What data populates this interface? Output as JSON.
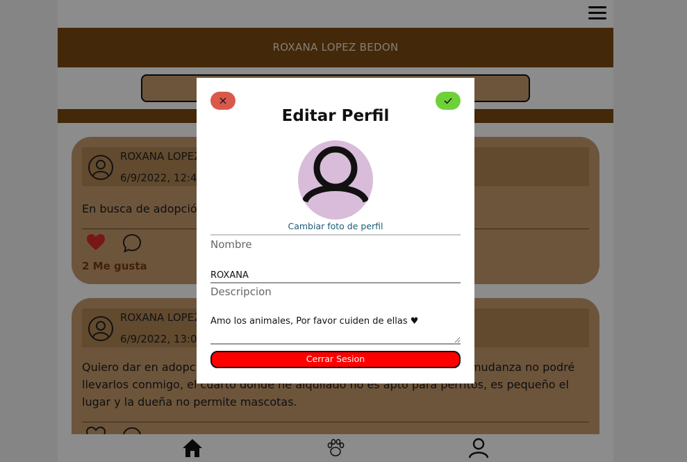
{
  "header": {
    "profile_name": "ROXANA LOPEZ BEDON"
  },
  "posts": [
    {
      "author": "ROXANA LOPEZ",
      "date": "6/9/2022, 12:45",
      "text": "En busca de adopción",
      "liked": true,
      "likes_label": "2 Me gusta"
    },
    {
      "author": "ROXANA LOPEZ",
      "date": "6/9/2022, 13:00",
      "text": "Quiero dar en adopción a mis perritos ya que estamos en proceso de mudanza no podré llevarlos conmigo, el cuarto donde he alquilado no es apto para perritos, es pequeño el lugar y la dueña no permite mascotas.",
      "liked": false
    }
  ],
  "modal": {
    "title": "Editar Perfil",
    "change_photo": "Cambiar foto de perfil",
    "nombre_label": "Nombre",
    "nombre_value": "ROXANA",
    "descripcion_label": "Descripcion",
    "descripcion_value": "Amo los animales, Por favor cuiden de ellas ♥",
    "logout_label": "Cerrar Sesion"
  },
  "colors": {
    "brand_brown": "#7a4a12",
    "card_tan": "#c69c6d",
    "close_red": "#d9594a",
    "confirm_green": "#6fd13a",
    "logout_red": "#ff0000",
    "avatar_lilac": "#d8bcd9"
  },
  "icons": {
    "menu": "hamburger-icon",
    "home": "home-icon",
    "paw": "paw-icon",
    "user": "user-icon",
    "like": "heart-icon",
    "comment": "comment-icon",
    "close": "close-icon",
    "confirm": "check-icon"
  }
}
